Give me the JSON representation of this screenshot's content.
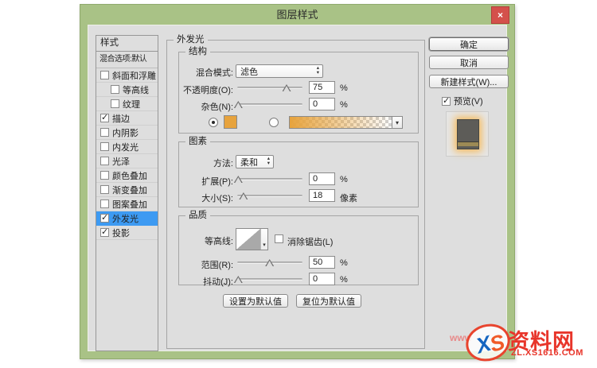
{
  "window": {
    "title": "图层样式",
    "close_label": "×"
  },
  "colors": {
    "frame_green": "#a9c286",
    "content_gray": "#dedede",
    "highlight_blue": "#3d9af2",
    "glow_orange": "#e7a33d",
    "close_red": "#d4514b"
  },
  "sidebar": {
    "header": "样式",
    "blending_item": "混合选项:默认",
    "items": [
      {
        "label": "斜面和浮雕",
        "checked": false,
        "indent": false,
        "selected": false
      },
      {
        "label": "等高线",
        "checked": false,
        "indent": true,
        "selected": false
      },
      {
        "label": "纹理",
        "checked": false,
        "indent": true,
        "selected": false
      },
      {
        "label": "描边",
        "checked": true,
        "indent": false,
        "selected": false
      },
      {
        "label": "内阴影",
        "checked": false,
        "indent": false,
        "selected": false
      },
      {
        "label": "内发光",
        "checked": false,
        "indent": false,
        "selected": false
      },
      {
        "label": "光泽",
        "checked": false,
        "indent": false,
        "selected": false
      },
      {
        "label": "颜色叠加",
        "checked": false,
        "indent": false,
        "selected": false
      },
      {
        "label": "渐变叠加",
        "checked": false,
        "indent": false,
        "selected": false
      },
      {
        "label": "图案叠加",
        "checked": false,
        "indent": false,
        "selected": false
      },
      {
        "label": "外发光",
        "checked": true,
        "indent": false,
        "selected": true
      },
      {
        "label": "投影",
        "checked": true,
        "indent": false,
        "selected": false
      }
    ]
  },
  "panel": {
    "title": "外发光",
    "structure": {
      "title": "结构",
      "blend_mode_label": "混合模式:",
      "blend_mode_value": "滤色",
      "opacity_label": "不透明度(O):",
      "opacity_value": "75",
      "opacity_unit": "%",
      "noise_label": "杂色(N):",
      "noise_value": "0",
      "noise_unit": "%"
    },
    "elements": {
      "title": "图素",
      "technique_label": "方法:",
      "technique_value": "柔和",
      "spread_label": "扩展(P):",
      "spread_value": "0",
      "spread_unit": "%",
      "size_label": "大小(S):",
      "size_value": "18",
      "size_unit": "像素"
    },
    "quality": {
      "title": "品质",
      "contour_label": "等高线:",
      "antialias_label": "消除锯齿(L)",
      "antialias_checked": false,
      "range_label": "范围(R):",
      "range_value": "50",
      "range_unit": "%",
      "jitter_label": "抖动(J):",
      "jitter_value": "0",
      "jitter_unit": "%"
    },
    "make_default": "设置为默认值",
    "reset_default": "复位为默认值"
  },
  "actions": {
    "ok": "确定",
    "cancel": "取消",
    "new_style": "新建样式(W)...",
    "preview": "预览(V)",
    "preview_checked": true
  },
  "watermark": {
    "www": "www",
    "logo_x": "X",
    "logo_s": "S",
    "site_name": "资料网",
    "site_url": "ZL.XS1616.COM"
  }
}
